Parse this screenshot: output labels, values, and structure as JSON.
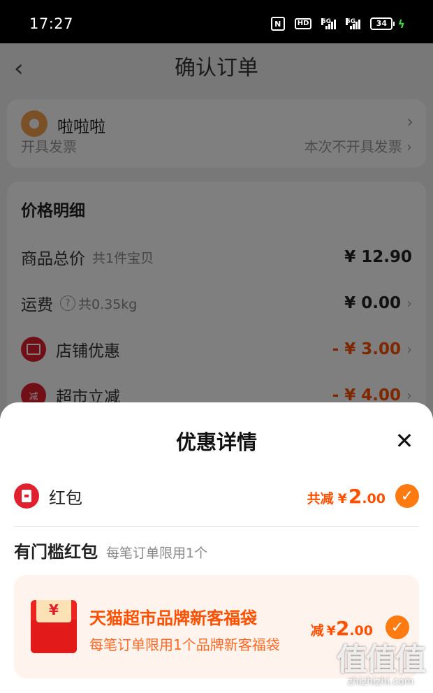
{
  "status_bar": {
    "time": "17:27",
    "network_a": "5G",
    "network_b": "5G",
    "hd": "HD",
    "battery": "34",
    "nfc": "N"
  },
  "nav": {
    "title": "确认订单",
    "back": "‹"
  },
  "address": {
    "name": "啦啦啦",
    "cut_left": "开具发票",
    "cut_right": "本次不开具发票 ›"
  },
  "price_detail": {
    "title": "价格明细",
    "rows": [
      {
        "label": "商品总价",
        "sub": "共1件宝贝",
        "amount": "¥ 12.90"
      },
      {
        "label": "运费",
        "sub": "共0.35kg",
        "amount": "¥ 0.00"
      },
      {
        "label": "店铺优惠",
        "amount": "- ¥ 3.00"
      },
      {
        "label": "超市立减",
        "icon_text": "减",
        "amount": "- ¥ 4.00"
      }
    ]
  },
  "sheet": {
    "title": "优惠详情",
    "close": "✕",
    "hongbao": {
      "label": "红包",
      "total_prefix": "共减",
      "currency": "¥",
      "amount": "2",
      "decimals": ".00"
    },
    "section": {
      "title": "有门槛红包",
      "note": "每笔订单限用1个"
    },
    "coupon": {
      "title": "天猫超市品牌新客福袋",
      "desc": "每笔订单限用1个品牌新客福袋",
      "prefix": "减",
      "currency": "¥",
      "amount": "2",
      "decimals": ".00",
      "envelope_symbol": "¥"
    }
  },
  "watermark": {
    "glyphs": "值值值",
    "url": "zhizhizhi.com"
  },
  "colors": {
    "accent": "#ff5000",
    "check": "#ff7a10",
    "red_icon": "#e0202c",
    "coupon_bg": "#fff3ee"
  },
  "check_mark": "✓"
}
